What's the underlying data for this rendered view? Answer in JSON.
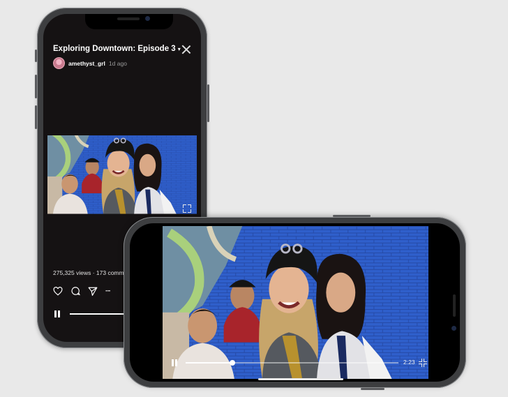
{
  "portrait": {
    "video_title": "Exploring Downtown: Episode 3",
    "title_caret": "▾",
    "username": "amethyst_grl",
    "posted_ago": "1d ago",
    "stats": "275,325 views · 173 comm",
    "icons": [
      "like-icon",
      "comment-icon",
      "share-icon",
      "more-icon"
    ],
    "more_glyph": "···",
    "progress": 0.63
  },
  "landscape": {
    "duration": "2:23",
    "progress": 0.22
  },
  "colors": {
    "background": "#e9e9e9",
    "phone_frame": "#3d3e40",
    "screen_dark": "#151213",
    "mural_blue": "#2f59c2"
  }
}
